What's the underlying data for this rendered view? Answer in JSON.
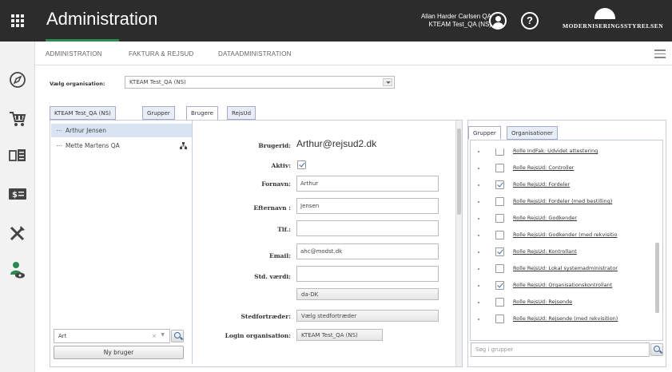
{
  "header": {
    "title": "Administration",
    "user_name": "Allan Harder Carlsen QA",
    "user_org": "KTEAM Test_QA (NS)",
    "logo_text": "MODERNISERINGSSTYRELSEN",
    "accent_color": "#2d8a4e",
    "bar_color": "#2c2c2c"
  },
  "subnav": {
    "items": [
      "ADMINISTRATION",
      "FAKTURA & REJSUD",
      "DATAADMINISTRATION"
    ]
  },
  "sidebar": {
    "icons": [
      "compass-icon",
      "cart-icon",
      "layout-icon",
      "money-icon",
      "tools-icon",
      "user-group-icon"
    ]
  },
  "org_selector": {
    "label": "Vælg organisation:",
    "value": "KTEAM Test_QA (NS)"
  },
  "tabs": [
    "KTEAM Test_QA (NS)",
    "Grupper",
    "Brugere",
    "RejsUd"
  ],
  "active_tab": "Brugere",
  "user_list": {
    "items": [
      "Arthur Jensen",
      "Mette Martens QA"
    ],
    "search_value": "Art",
    "new_user_label": "Ny bruger"
  },
  "form": {
    "userid_label": "Brugerid:",
    "userid_value": "Arthur@rejsud2.dk",
    "active_label": "Aktiv:",
    "firstname_label": "Fornavn:",
    "firstname_value": "Arthur",
    "lastname_label": "Efternavn :",
    "lastname_value": "Jensen",
    "phone_label": "Tlf.:",
    "phone_value": "",
    "email_label": "Email:",
    "email_value": "ahc@modst.dk",
    "default_label": "Std. værdi:",
    "default_value": "",
    "locale_value": "da-DK",
    "deputy_label": "Stedfortræder:",
    "deputy_button": "Vælg stedfortræder",
    "login_org_label": "Login organisation:",
    "login_org_value": "KTEAM Test_QA (NS)"
  },
  "groups_panel": {
    "tabs": [
      "Grupper",
      "Organisationer"
    ],
    "items": [
      {
        "label": "Rolle IndFak: Udvidet attestering",
        "checked": false
      },
      {
        "label": "Rolle RejsUd: Controller",
        "checked": false
      },
      {
        "label": "Rolle RejsUd: Fordeler",
        "checked": true
      },
      {
        "label": "Rolle RejsUd: Fordeler (med bestilling)",
        "checked": false
      },
      {
        "label": "Rolle RejsUd: Godkender",
        "checked": false
      },
      {
        "label": "Rolle RejsUd: Godkender (med rekvisitio",
        "checked": false
      },
      {
        "label": "Rolle RejsUd: Kontrollant",
        "checked": true
      },
      {
        "label": "Rolle RejsUd: Lokal systemadministrator",
        "checked": false
      },
      {
        "label": "Rolle RejsUd: Organisationskontrollant",
        "checked": true
      },
      {
        "label": "Rolle RejsUd: Rejsende",
        "checked": false
      },
      {
        "label": "Rolle RejsUd: Rejsende (med rekvisition)",
        "checked": false
      }
    ],
    "search_placeholder": "Søg i grupper"
  }
}
